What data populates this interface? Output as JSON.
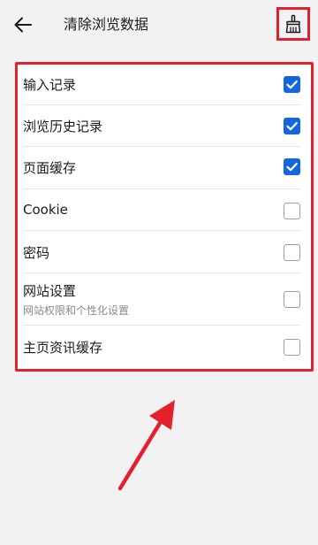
{
  "header": {
    "title": "清除浏览数据",
    "back_icon": "arrow-left-icon",
    "clean_icon": "broom-icon"
  },
  "options": [
    {
      "label": "输入记录",
      "checked": true
    },
    {
      "label": "浏览历史记录",
      "checked": true
    },
    {
      "label": "页面缓存",
      "checked": true
    },
    {
      "label": "Cookie",
      "checked": false
    },
    {
      "label": "密码",
      "checked": false
    },
    {
      "label": "网站设置",
      "sublabel": "网站权限和个性化设置",
      "checked": false
    },
    {
      "label": "主页资讯缓存",
      "checked": false
    }
  ],
  "colors": {
    "checkbox_checked": "#1466e0",
    "annotation": "#e5202d",
    "background": "#f2f2f4"
  }
}
